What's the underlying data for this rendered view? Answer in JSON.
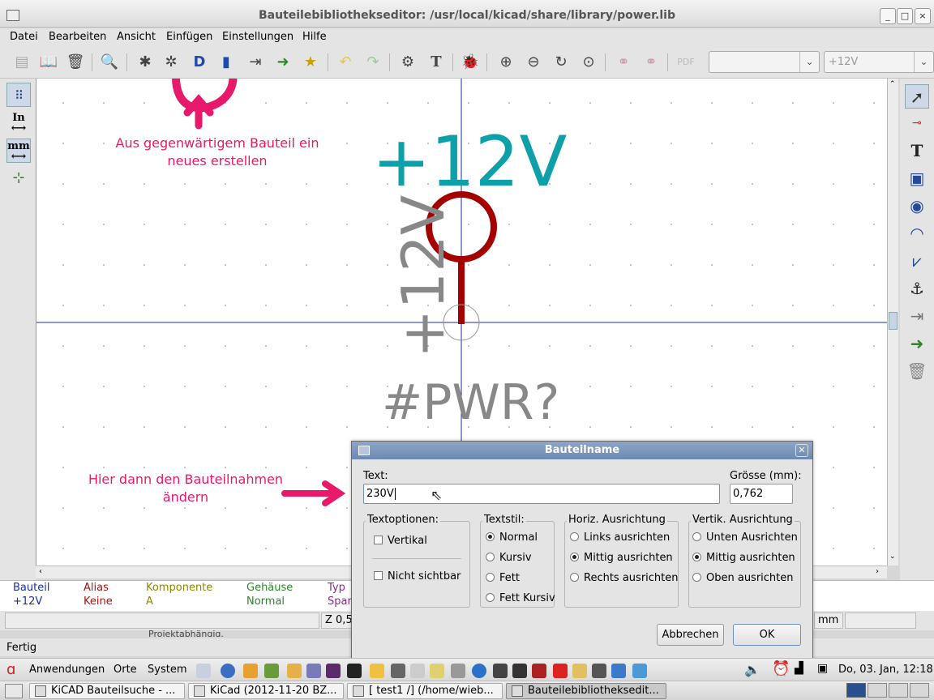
{
  "window": {
    "title": "Bauteilebibliothekseditor: /usr/local/kicad/share/library/power.lib",
    "buttons": [
      "_",
      "□",
      "×"
    ]
  },
  "menu": [
    "Datei",
    "Bearbeiten",
    "Ansicht",
    "Einfügen",
    "Einstellungen",
    "Hilfe"
  ],
  "toolbar": {
    "combo1_value": "",
    "combo2_value": "+12V",
    "icons": [
      "save-lib",
      "library",
      "delete",
      "view-lib",
      "new-part",
      "load-part",
      "create-from-current",
      "save-part",
      "import",
      "export",
      "add-to-lib",
      "undo",
      "redo",
      "ercc",
      "text",
      "bug",
      "zoom-in",
      "zoom-out",
      "refresh",
      "zoom-fit",
      "pin-a",
      "pin-b",
      "pdf"
    ]
  },
  "left_toolbar": {
    "units_in": "In",
    "units_mm": "mm"
  },
  "canvas": {
    "value_text": "+12V",
    "rotated_text": "+12V",
    "reference_text": "#PWR?"
  },
  "annotations": {
    "top": "Aus gegenwärtigem Bauteil ein neues erstellen",
    "bottom": "Hier dann den Bauteilnahmen ändern"
  },
  "infobar": {
    "col1_head": "Bauteil",
    "col1_val": "+12V",
    "col2_head": "Alias",
    "col2_val": "Keine",
    "col3_head": "Komponente",
    "col3_val": "A",
    "col4_head": "Gehäuse",
    "col4_val": "Normal",
    "col5_head": "Typ",
    "col5_val": "Span"
  },
  "status": {
    "zoom": "Z 0,5",
    "units": "mm",
    "message": "Fertig",
    "cut_text": "Projektabhängig."
  },
  "dialog": {
    "title": "Bauteilname",
    "text_label": "Text:",
    "text_value": "230V",
    "size_label": "Grösse (mm):",
    "size_value": "0,762",
    "textoptionen": {
      "label": "Textoptionen:",
      "vertikal": "Vertikal",
      "nicht_sichtbar": "Nicht sichtbar"
    },
    "textstil": {
      "label": "Textstil:",
      "options": [
        "Normal",
        "Kursiv",
        "Fett",
        "Fett Kursiv"
      ],
      "selected": 0
    },
    "horiz": {
      "label": "Horiz. Ausrichtung",
      "options": [
        "Links ausrichten",
        "Mittig ausrichten",
        "Rechts ausrichten"
      ],
      "selected": 1
    },
    "vertik": {
      "label": "Vertik. Ausrichtung",
      "options": [
        "Unten Ausrichten",
        "Mittig ausrichten",
        "Oben ausrichten"
      ],
      "selected": 1
    },
    "cancel": "Abbrechen",
    "ok": "OK"
  },
  "taskbar": {
    "menu": [
      "Anwendungen",
      "Orte",
      "System"
    ],
    "clock": "Do, 03. Jan, 12:18",
    "tasks": [
      "KiCAD Bauteilsuche - ...",
      "KiCad (2012-11-20 BZ...",
      "[ test1 /] (/home/wieb...",
      "Bauteilebibliotheksedit..."
    ]
  },
  "colors": {
    "accent": "#e8196a",
    "canvas_value": "#0ea0a8",
    "pin": "#a50000",
    "grey_text": "#888888",
    "axis": "#1a2fa0"
  }
}
